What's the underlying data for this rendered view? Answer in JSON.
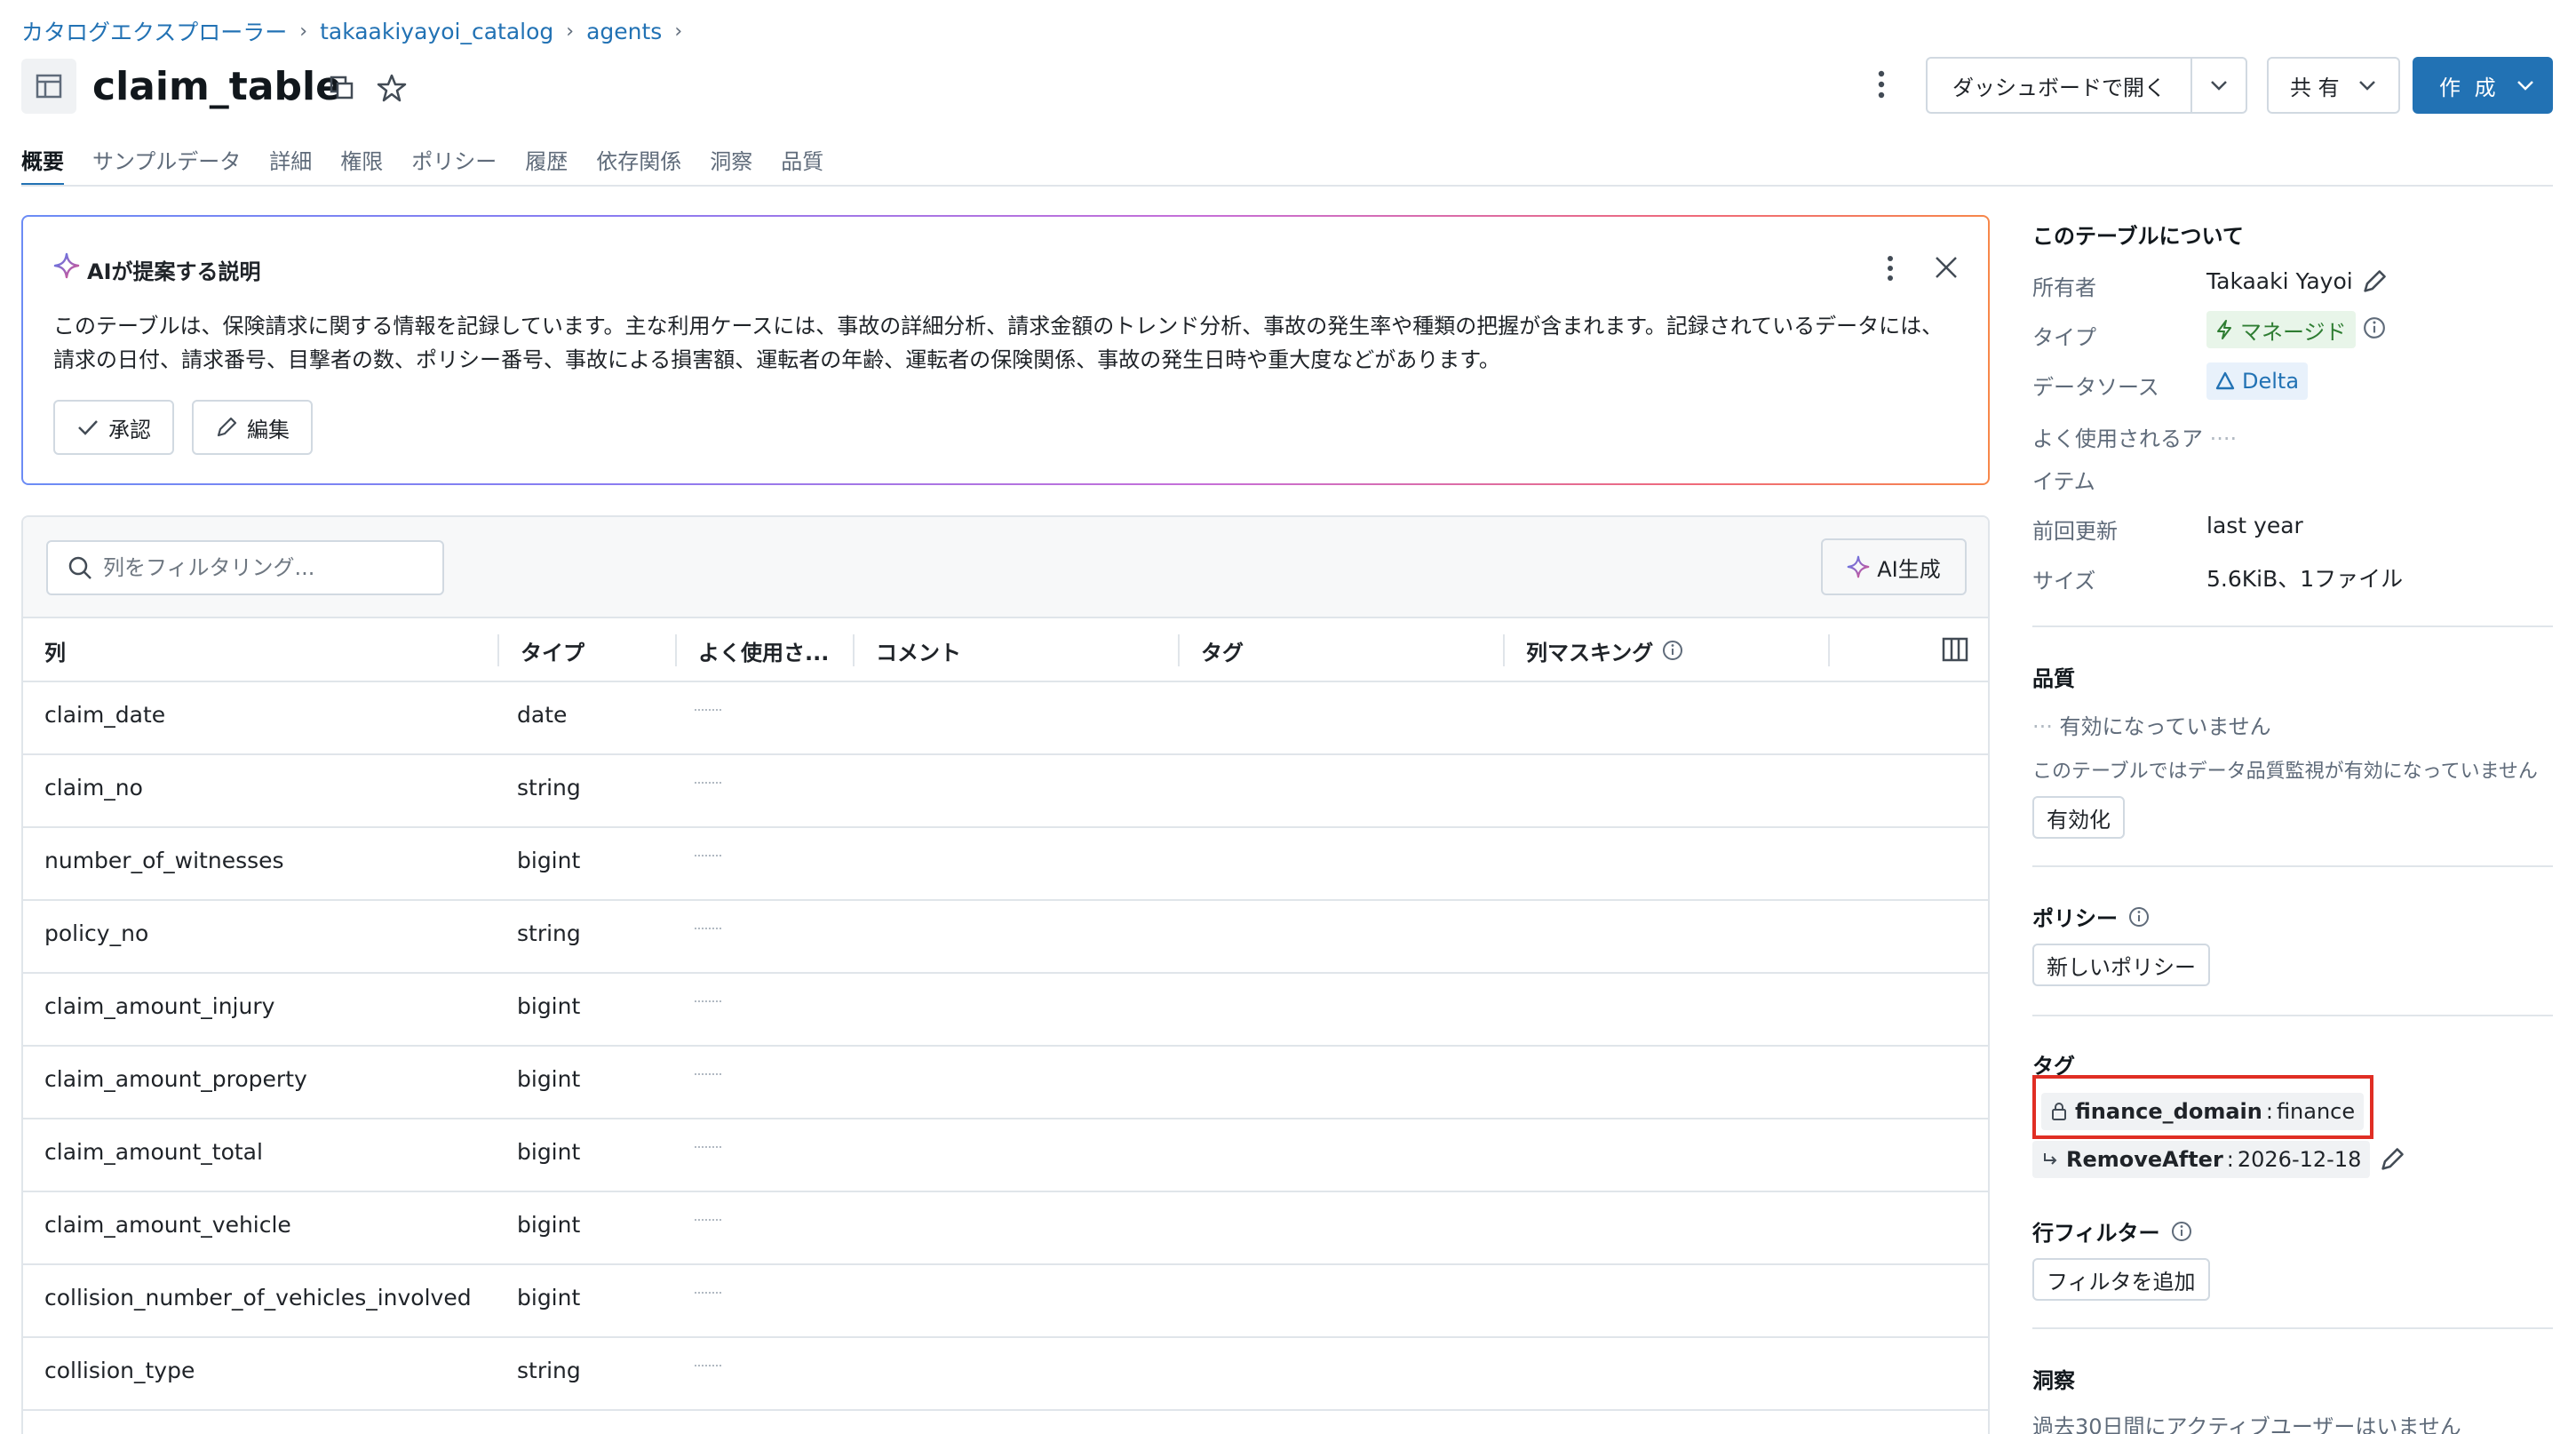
{
  "breadcrumb": {
    "items": [
      "カタログエクスプローラー",
      "takaakiyayoi_catalog",
      "agents"
    ]
  },
  "header": {
    "title": "claim_table",
    "open_dashboard": "ダッシュボードで開く",
    "share": "共 有",
    "create": "作 成"
  },
  "tabs": [
    "概要",
    "サンプルデータ",
    "詳細",
    "権限",
    "ポリシー",
    "履歴",
    "依存関係",
    "洞察",
    "品質"
  ],
  "ai_box": {
    "title": "AIが提案する説明",
    "line1": "このテーブルは、保険請求に関する情報を記録しています。主な利用ケースには、事故の詳細分析、請求金額のトレンド分析、事故の発生率や種類の把握が含まれます。記録されているデータには、",
    "line2": "請求の日付、請求番号、目撃者の数、ポリシー番号、事故による損害額、運転者の年齢、運転者の保険関係、事故の発生日時や重大度などがあります。",
    "approve": "承認",
    "edit": "編集"
  },
  "table": {
    "filter_placeholder": "列をフィルタリング...",
    "ai_generate": "AI生成",
    "headers": [
      "列",
      "タイプ",
      "よく使用さ...",
      "コメント",
      "タグ",
      "列マスキング"
    ],
    "rows": [
      {
        "name": "claim_date",
        "type": "date"
      },
      {
        "name": "claim_no",
        "type": "string"
      },
      {
        "name": "number_of_witnesses",
        "type": "bigint"
      },
      {
        "name": "policy_no",
        "type": "string"
      },
      {
        "name": "claim_amount_injury",
        "type": "bigint"
      },
      {
        "name": "claim_amount_property",
        "type": "bigint"
      },
      {
        "name": "claim_amount_total",
        "type": "bigint"
      },
      {
        "name": "claim_amount_vehicle",
        "type": "bigint"
      },
      {
        "name": "collision_number_of_vehicles_involved",
        "type": "bigint"
      },
      {
        "name": "collision_type",
        "type": "string"
      }
    ]
  },
  "sidebar": {
    "about_title": "このテーブルについて",
    "owner_label": "所有者",
    "owner_value": "Takaaki Yayoi",
    "type_label": "タイプ",
    "type_value": "マネージド",
    "datasource_label": "データソース",
    "datasource_value": "Delta",
    "frequent_label_1": "よく使用されるア",
    "frequent_label_2": "イテム",
    "updated_label": "前回更新",
    "updated_value": "last year",
    "size_label": "サイズ",
    "size_value": "5.6KiB、1ファイル",
    "quality_title": "品質",
    "quality_status": "有効になっていません",
    "quality_desc": "このテーブルではデータ品質監視が有効になっていません",
    "quality_enable": "有効化",
    "policy_title": "ポリシー",
    "policy_new": "新しいポリシー",
    "tags_title": "タグ",
    "tag1_key": "finance_domain",
    "tag1_value": "finance",
    "tag2_key": "RemoveAfter",
    "tag2_value": "2026-12-18",
    "tag_sep": ":",
    "rowfilter_title": "行フィルター",
    "rowfilter_add": "フィルタを追加",
    "insights_title": "洞察",
    "insights_desc": "過去30日間にアクティブユーザーはいません"
  },
  "colors": {
    "link": "#2272b4",
    "primary_button": "#2272b4",
    "managed_green": "#2e7d32",
    "highlight_red": "#e02e24"
  }
}
